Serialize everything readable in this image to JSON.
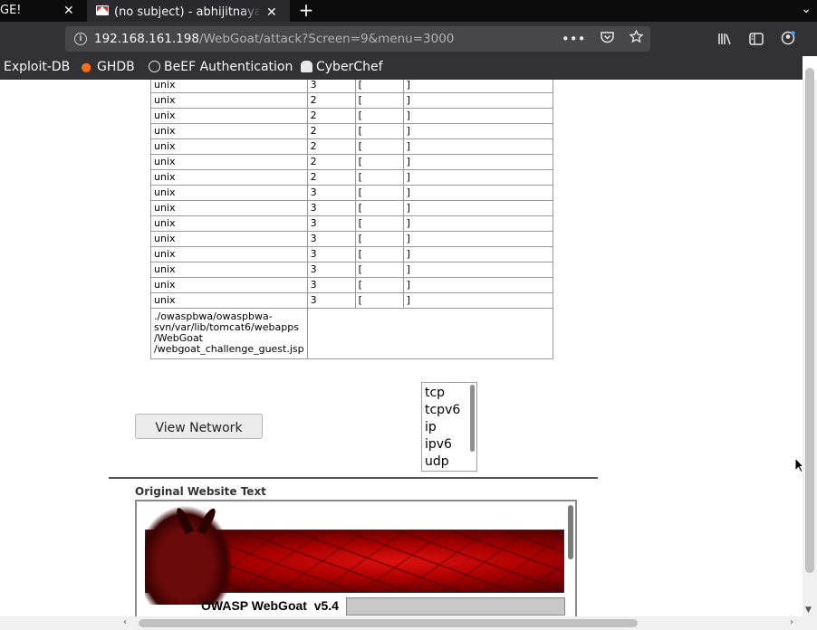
{
  "tabs": [
    {
      "title": "GE!",
      "close": "✕"
    },
    {
      "title": "(no subject) - abhijitnayak",
      "close": "✕",
      "icon": "gmail-icon"
    }
  ],
  "new_tab": "+",
  "tabstrip_menu": "⌄",
  "urlbar": {
    "host": "192.168.161.198",
    "path": "/WebGoat/attack?Screen=9&menu=3000",
    "actions": [
      "•••",
      "pocket-icon",
      "star-icon"
    ]
  },
  "toolbar_icons": [
    "library-icon",
    "sidebar-icon",
    "account-icon"
  ],
  "bookmarks": [
    {
      "label": "Exploit-DB"
    },
    {
      "label": "GHDB",
      "icon": "ghdb-icon"
    },
    {
      "label": "BeEF Authentication",
      "icon": "globe-icon"
    },
    {
      "label": "CyberChef",
      "icon": "chef-icon"
    }
  ],
  "process_table": {
    "rows": [
      [
        "unix",
        "3",
        "[",
        "]"
      ],
      [
        "unix",
        "2",
        "[",
        "]"
      ],
      [
        "unix",
        "2",
        "[",
        "]"
      ],
      [
        "unix",
        "2",
        "[",
        "]"
      ],
      [
        "unix",
        "2",
        "[",
        "]"
      ],
      [
        "unix",
        "2",
        "[",
        "]"
      ],
      [
        "unix",
        "2",
        "[",
        "]"
      ],
      [
        "unix",
        "3",
        "[",
        "]"
      ],
      [
        "unix",
        "3",
        "[",
        "]"
      ],
      [
        "unix",
        "3",
        "[",
        "]"
      ],
      [
        "unix",
        "3",
        "[",
        "]"
      ],
      [
        "unix",
        "3",
        "[",
        "]"
      ],
      [
        "unix",
        "3",
        "[",
        "]"
      ],
      [
        "unix",
        "3",
        "[",
        "]"
      ],
      [
        "unix",
        "3",
        "[",
        "]"
      ]
    ],
    "path_lines": [
      "./owaspbwa/owaspbwa-",
      "svn/var/lib/tomcat6/webapps",
      "/WebGoat",
      "/webgoat_challenge_guest.jsp"
    ]
  },
  "view_network_button": "View Network",
  "protocol_list": [
    "tcp",
    "tcpv6",
    "ip",
    "ipv6",
    "udp"
  ],
  "original_text_label": "Original Website Text",
  "webgoat_title": "OWASP WebGoat  v5.4"
}
